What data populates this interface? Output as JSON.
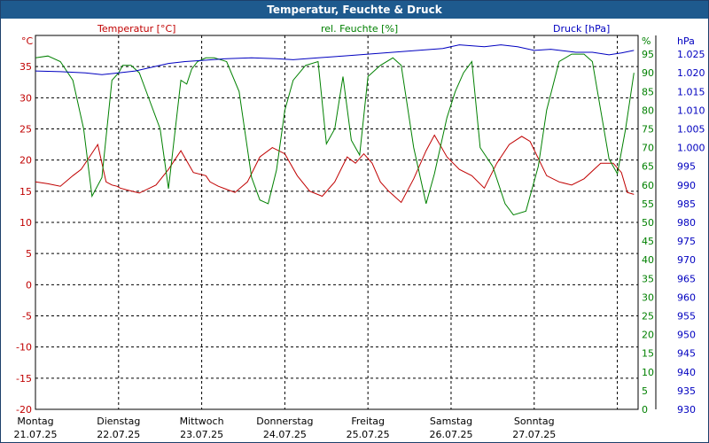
{
  "chart_data": {
    "type": "line",
    "title": "Temperatur, Feuchte & Druck",
    "x_days": [
      {
        "day": "Montag",
        "date": "21.07.25"
      },
      {
        "day": "Dienstag",
        "date": "22.07.25"
      },
      {
        "day": "Mittwoch",
        "date": "23.07.25"
      },
      {
        "day": "Donnerstag",
        "date": "24.07.25"
      },
      {
        "day": "Freitag",
        "date": "25.07.25"
      },
      {
        "day": "Samstag",
        "date": "26.07.25"
      },
      {
        "day": "Sonntag",
        "date": "27.07.25"
      }
    ],
    "x_range_days": [
      0,
      7.25
    ],
    "grid": true,
    "axes": {
      "temperature": {
        "label": "Temperatur [°C]",
        "unit": "°C",
        "range": [
          -20,
          40
        ],
        "ticks": [
          35,
          30,
          25,
          20,
          15,
          10,
          5,
          0,
          -5,
          -10,
          -15,
          -20
        ],
        "side": "left",
        "color": "#c00000"
      },
      "humidity": {
        "label": "rel. Feuchte [%]",
        "unit": "%",
        "range": [
          0,
          100
        ],
        "ticks": [
          95,
          90,
          85,
          80,
          75,
          70,
          65,
          60,
          55,
          50,
          45,
          40,
          35,
          30,
          25,
          20,
          15,
          10,
          5,
          0
        ],
        "side": "right",
        "color": "#008000"
      },
      "pressure": {
        "label": "Druck [hPa]",
        "unit": "hPa",
        "range": [
          930,
          1030
        ],
        "ticks": [
          "1.025",
          "1.020",
          "1.015",
          "1.010",
          "1.005",
          "1.000",
          "995",
          "990",
          "985",
          "980",
          "975",
          "970",
          "965",
          "960",
          "955",
          "950",
          "945",
          "940",
          "935",
          "930"
        ],
        "side": "right",
        "color": "#0000c0"
      }
    },
    "series": [
      {
        "name": "Temperatur [°C]",
        "axis": "temperature",
        "color": "#c00000",
        "x": [
          0,
          0.15,
          0.3,
          0.45,
          0.55,
          0.65,
          0.75,
          0.85,
          0.92,
          0.98,
          1.02,
          1.1,
          1.25,
          1.45,
          1.6,
          1.75,
          1.9,
          2.05,
          2.1,
          2.2,
          2.4,
          2.55,
          2.7,
          2.85,
          3.0,
          3.15,
          3.3,
          3.45,
          3.6,
          3.75,
          3.85,
          3.95,
          4.05,
          4.15,
          4.25,
          4.4,
          4.55,
          4.7,
          4.8,
          4.95,
          5.1,
          5.25,
          5.4,
          5.55,
          5.7,
          5.85,
          5.95,
          6.15,
          6.3,
          6.45,
          6.6,
          6.8,
          6.95,
          7.05,
          7.12,
          7.2
        ],
        "y": [
          16.5,
          16.2,
          15.8,
          17.5,
          18.5,
          20.5,
          22.5,
          16.5,
          16.0,
          15.8,
          15.5,
          15.2,
          14.7,
          16.0,
          18.5,
          21.5,
          18.0,
          17.5,
          16.5,
          15.8,
          14.8,
          16.5,
          20.5,
          22.0,
          21.0,
          17.5,
          15.0,
          14.2,
          16.5,
          20.5,
          19.5,
          21.0,
          19.5,
          16.5,
          15.0,
          13.2,
          17.0,
          21.5,
          24.0,
          20.5,
          18.5,
          17.5,
          15.5,
          19.5,
          22.5,
          23.8,
          23.0,
          17.5,
          16.5,
          16.0,
          17.0,
          19.5,
          19.5,
          18.0,
          14.8,
          14.5
        ]
      },
      {
        "name": "rel. Feuchte [%]",
        "axis": "humidity",
        "color": "#008000",
        "x": [
          0,
          0.15,
          0.3,
          0.45,
          0.58,
          0.68,
          0.8,
          0.92,
          1.0,
          1.05,
          1.15,
          1.25,
          1.35,
          1.5,
          1.6,
          1.75,
          1.82,
          1.88,
          1.95,
          2.05,
          2.15,
          2.3,
          2.45,
          2.6,
          2.7,
          2.8,
          2.9,
          3.0,
          3.1,
          3.25,
          3.4,
          3.5,
          3.6,
          3.7,
          3.8,
          3.9,
          4.0,
          4.15,
          4.3,
          4.4,
          4.55,
          4.7,
          4.8,
          4.95,
          5.05,
          5.15,
          5.25,
          5.35,
          5.5,
          5.65,
          5.75,
          5.9,
          6.05,
          6.15,
          6.3,
          6.45,
          6.6,
          6.7,
          6.8,
          6.9,
          7.0,
          7.1,
          7.2
        ],
        "y": [
          94,
          94.5,
          93,
          88,
          75,
          57,
          62,
          88,
          90,
          92,
          92,
          90,
          84,
          75,
          59,
          88,
          87,
          91,
          93,
          94,
          94,
          93,
          85,
          62,
          56,
          55,
          64,
          80,
          88,
          92,
          93,
          71,
          75,
          89,
          72,
          68,
          89,
          92,
          94,
          92,
          70,
          55,
          63,
          78,
          85,
          90,
          93,
          70,
          65,
          55,
          52,
          53,
          65,
          80,
          93,
          95,
          95,
          93,
          80,
          67,
          63,
          75,
          90
        ]
      },
      {
        "name": "Druck [hPa]",
        "axis": "pressure",
        "color": "#0000c0",
        "x": [
          0,
          0.3,
          0.6,
          0.8,
          1.0,
          1.2,
          1.4,
          1.6,
          1.8,
          2.0,
          2.3,
          2.6,
          2.9,
          3.1,
          3.4,
          3.7,
          4.0,
          4.3,
          4.6,
          4.9,
          5.1,
          5.4,
          5.6,
          5.8,
          6.0,
          6.2,
          6.5,
          6.7,
          6.9,
          7.05,
          7.2
        ],
        "y": [
          1020.5,
          1020.3,
          1020.0,
          1019.5,
          1020.0,
          1020.5,
          1021.5,
          1022.5,
          1023.0,
          1023.3,
          1023.8,
          1024.0,
          1023.8,
          1023.5,
          1024.0,
          1024.5,
          1025.0,
          1025.5,
          1026.0,
          1026.5,
          1027.5,
          1027.0,
          1027.5,
          1027.0,
          1026.0,
          1026.3,
          1025.5,
          1025.5,
          1024.8,
          1025.3,
          1026.0
        ]
      }
    ]
  }
}
